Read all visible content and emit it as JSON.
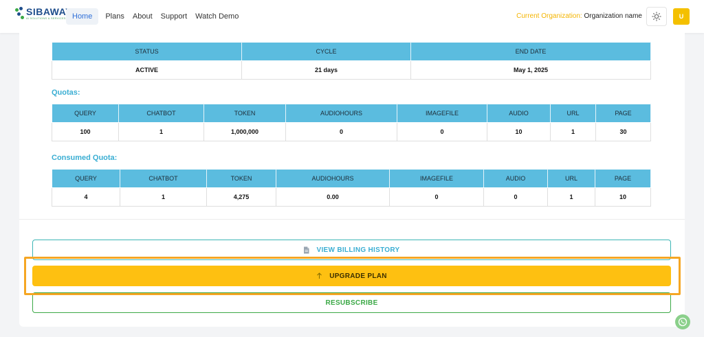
{
  "header": {
    "logo": {
      "name": "SIBAWAY",
      "tagline": "AI SOLUTIONS & SERVICES"
    },
    "nav": [
      {
        "label": "Home",
        "active": true
      },
      {
        "label": "Plans",
        "active": false
      },
      {
        "label": "About",
        "active": false
      },
      {
        "label": "Support",
        "active": false
      },
      {
        "label": "Watch Demo",
        "active": false
      }
    ],
    "org_label": "Current Organization:",
    "org_value": "Organization name",
    "avatar_letter": "U",
    "theme_icon": "sun-icon"
  },
  "subscription": {
    "headers": [
      "STATUS",
      "CYCLE",
      "END DATE"
    ],
    "row": [
      "ACTIVE",
      "21 days",
      "May 1, 2025"
    ]
  },
  "quotas": {
    "title": "Quotas:",
    "headers": [
      "QUERY",
      "CHATBOT",
      "TOKEN",
      "AUDIOHOURS",
      "IMAGEFILE",
      "AUDIO",
      "URL",
      "PAGE"
    ],
    "row": [
      "100",
      "1",
      "1,000,000",
      "0",
      "0",
      "10",
      "1",
      "30"
    ]
  },
  "consumed": {
    "title": "Consumed Quota:",
    "headers": [
      "QUERY",
      "CHATBOT",
      "TOKEN",
      "AUDIOHOURS",
      "IMAGEFILE",
      "AUDIO",
      "URL",
      "PAGE"
    ],
    "row": [
      "4",
      "1",
      "4,275",
      "0.00",
      "0",
      "0",
      "1",
      "10"
    ]
  },
  "actions": {
    "billing_label": "VIEW BILLING HISTORY",
    "billing_icon": "document-icon",
    "upgrade_label": "UPGRADE PLAN",
    "upgrade_icon": "arrow-up-icon",
    "resubscribe_label": "RESUBSCRIBE"
  },
  "colors": {
    "table_header": "#5bbcdf",
    "accent_teal": "#3aaed3",
    "upgrade_yellow": "#fec011",
    "resubscribe_green": "#3aa845",
    "highlight_orange": "#f5a623"
  }
}
